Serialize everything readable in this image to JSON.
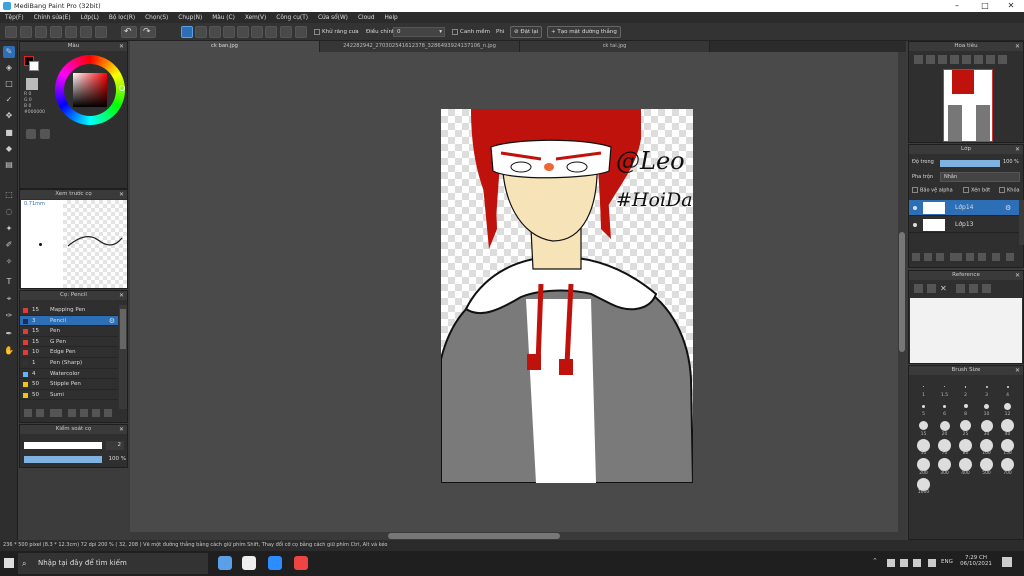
{
  "window": {
    "title": "MediBang Paint Pro (32bit)"
  },
  "menu": [
    "Tệp(F)",
    "Chỉnh sửa(E)",
    "Lớp(L)",
    "Bộ lọc(R)",
    "Chọn(S)",
    "Chụp(N)",
    "Màu (C)",
    "Xem(V)",
    "Công cụ(T)",
    "Cửa sổ(W)",
    "Cloud",
    "Help"
  ],
  "toolbar": {
    "antialias": "Khử răng cưa",
    "correction_label": "Điều chỉnh",
    "correction_value": "0",
    "snap": "Canh mềm",
    "snap_label": "Phi",
    "off_label": "Đặt lại",
    "ruler_btn": "Tạo mặt đường thẳng"
  },
  "tabs": [
    "ck ban.jpg",
    "242282942_270302541612378_3286493924137106_n.jpg",
    "ck tai.jpg"
  ],
  "color_panel": {
    "title": "Màu",
    "r": "R 0",
    "g": "G 0",
    "b": "B 0",
    "hex": "#000000"
  },
  "brush_preview": {
    "title": "Xem trước cọ",
    "size": "0.71mm"
  },
  "brush_panel": {
    "title": "Cọ: Pencil",
    "items": [
      {
        "num": "15",
        "name": "Mapping Pen",
        "color": "#e53935"
      },
      {
        "num": "3",
        "name": "Pencil",
        "color": "#1e2a60"
      },
      {
        "num": "15",
        "name": "Pen",
        "color": "#e53935"
      },
      {
        "num": "15",
        "name": "G Pen",
        "color": "#e53935"
      },
      {
        "num": "10",
        "name": "Edge Pen",
        "color": "#e53935"
      },
      {
        "num": "1",
        "name": "Pen (Sharp)",
        "color": "#333333"
      },
      {
        "num": "4",
        "name": "Watercolor",
        "color": "#64b5f6"
      },
      {
        "num": "50",
        "name": "Stipple Pen",
        "color": "#f1c40f"
      },
      {
        "num": "50",
        "name": "Sumi",
        "color": "#f1c40f"
      }
    ]
  },
  "brush_control": {
    "title": "Kiểm soát cọ",
    "size": "2",
    "opacity": "100 %"
  },
  "navigator": {
    "title": "Hoa tiêu"
  },
  "layer_panel": {
    "title": "Lớp",
    "opacity_label": "Độ trong",
    "opacity_value": "100 %",
    "blend_label": "Pha trộn",
    "blend_value": "Nhân",
    "protect_alpha": "Bảo vệ alpha",
    "clip": "Xén bớt",
    "lock": "Khóa",
    "layers": [
      "Lớp14",
      "Lớp13"
    ]
  },
  "reference": {
    "title": "Reference"
  },
  "brush_size": {
    "title": "Brush Size",
    "labels": [
      "1",
      "1.5",
      "2",
      "3",
      "4",
      "5",
      "6",
      "8",
      "10",
      "12",
      "15",
      "20",
      "25",
      "30",
      "40",
      "50",
      "70",
      "80",
      "100",
      "150",
      "200",
      "300",
      "400",
      "500",
      "700",
      "1000"
    ]
  },
  "artwork": {
    "signature": "@Leo",
    "hashtag": "#HoiDap"
  },
  "status": "236 * 500 pixel  (8.3 * 12.3cm)  72 dpi  200 %  ( 32, 208 )  Vẽ một đường thẳng bằng cách giữ phím Shift, Thay đổi cỡ cọ bằng cách giữ phím Ctrl, Alt và kéo",
  "taskbar": {
    "search_placeholder": "Nhập tại đây để tìm kiếm",
    "time": "7:29 CH",
    "date": "06/10/2021",
    "lang": "ENG"
  }
}
